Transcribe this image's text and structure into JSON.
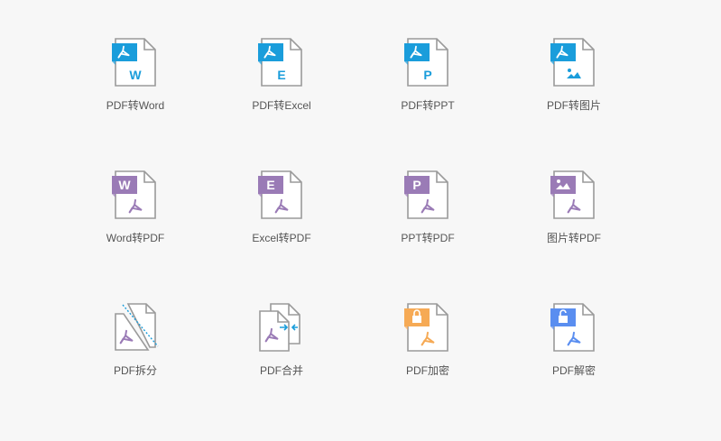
{
  "colors": {
    "blue": "#1a9ddb",
    "purple": "#9a7bb6",
    "orange": "#f6aa55",
    "lightblue": "#5a8ef0",
    "border": "#9a9a9a"
  },
  "tools": [
    {
      "label": "PDF转Word",
      "icon": "pdf-to-word-icon",
      "kind": "from",
      "tag": "W",
      "color": "blue"
    },
    {
      "label": "PDF转Excel",
      "icon": "pdf-to-excel-icon",
      "kind": "from",
      "tag": "E",
      "color": "blue"
    },
    {
      "label": "PDF转PPT",
      "icon": "pdf-to-ppt-icon",
      "kind": "from",
      "tag": "P",
      "color": "blue"
    },
    {
      "label": "PDF转图片",
      "icon": "pdf-to-image-icon",
      "kind": "from",
      "tag": "img",
      "color": "blue"
    },
    {
      "label": "Word转PDF",
      "icon": "word-to-pdf-icon",
      "kind": "to",
      "tag": "W",
      "color": "purple"
    },
    {
      "label": "Excel转PDF",
      "icon": "excel-to-pdf-icon",
      "kind": "to",
      "tag": "E",
      "color": "purple"
    },
    {
      "label": "PPT转PDF",
      "icon": "ppt-to-pdf-icon",
      "kind": "to",
      "tag": "P",
      "color": "purple"
    },
    {
      "label": "图片转PDF",
      "icon": "image-to-pdf-icon",
      "kind": "to",
      "tag": "img",
      "color": "purple"
    },
    {
      "label": "PDF拆分",
      "icon": "pdf-split-icon",
      "kind": "split",
      "color": "purple"
    },
    {
      "label": "PDF合并",
      "icon": "pdf-merge-icon",
      "kind": "merge",
      "color": "purple"
    },
    {
      "label": "PDF加密",
      "icon": "pdf-encrypt-icon",
      "kind": "lock",
      "color": "orange"
    },
    {
      "label": "PDF解密",
      "icon": "pdf-decrypt-icon",
      "kind": "unlock",
      "color": "lightblue"
    }
  ]
}
